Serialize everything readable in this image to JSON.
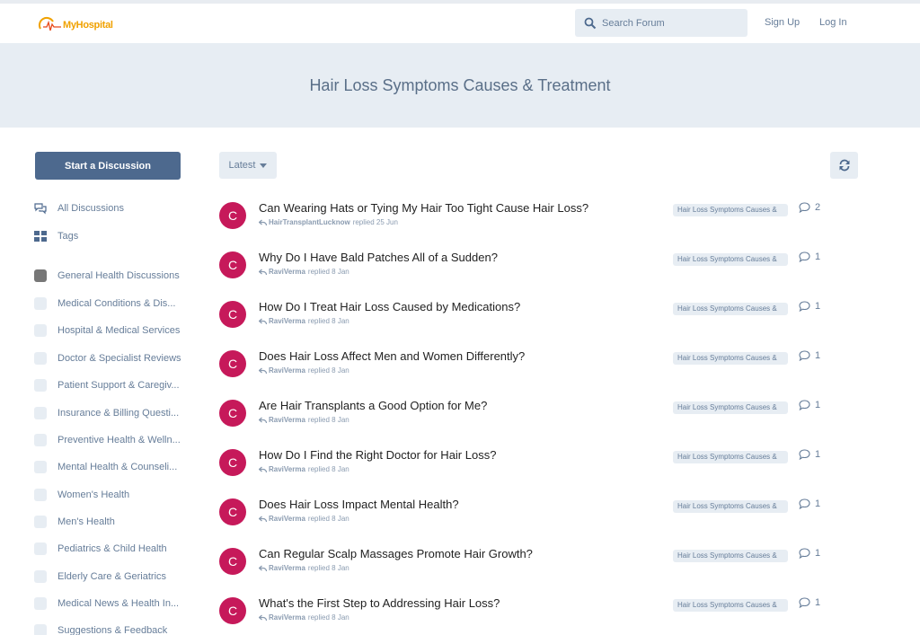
{
  "header": {
    "logo_text": "MyHospital",
    "search_placeholder": "Search Forum",
    "signup_label": "Sign Up",
    "login_label": "Log In"
  },
  "hero": {
    "title": "Hair Loss Symptoms Causes & Treatment"
  },
  "sidebar": {
    "start_label": "Start a Discussion",
    "nav": [
      {
        "label": "All Discussions",
        "icon": "comments-icon"
      },
      {
        "label": "Tags",
        "icon": "tags-grid-icon"
      }
    ],
    "tags": [
      {
        "label": "General Health Discussions"
      },
      {
        "label": "Medical Conditions & Dis..."
      },
      {
        "label": "Hospital & Medical Services"
      },
      {
        "label": "Doctor & Specialist Reviews"
      },
      {
        "label": "Patient Support & Caregiv..."
      },
      {
        "label": "Insurance & Billing Questi..."
      },
      {
        "label": "Preventive Health & Welln..."
      },
      {
        "label": "Mental Health & Counseli..."
      },
      {
        "label": "Women's Health"
      },
      {
        "label": "Men's Health"
      },
      {
        "label": "Pediatrics & Child Health"
      },
      {
        "label": "Elderly Care & Geriatrics"
      },
      {
        "label": "Medical News & Health In..."
      },
      {
        "label": "Suggestions & Feedback"
      }
    ]
  },
  "toolbar": {
    "sort_label": "Latest"
  },
  "discussions": [
    {
      "avatar": "C",
      "title": "Can Wearing Hats or Tying My Hair Too Tight Cause Hair Loss?",
      "user": "HairTransplantLucknow",
      "action": "replied 25 Jun",
      "tag": "Hair Loss Symptoms Causes &",
      "replies": "2"
    },
    {
      "avatar": "C",
      "title": "Why Do I Have Bald Patches All of a Sudden?",
      "user": "RaviVerma",
      "action": "replied 8 Jan",
      "tag": "Hair Loss Symptoms Causes &",
      "replies": "1"
    },
    {
      "avatar": "C",
      "title": "How Do I Treat Hair Loss Caused by Medications?",
      "user": "RaviVerma",
      "action": "replied 8 Jan",
      "tag": "Hair Loss Symptoms Causes &",
      "replies": "1"
    },
    {
      "avatar": "C",
      "title": "Does Hair Loss Affect Men and Women Differently?",
      "user": "RaviVerma",
      "action": "replied 8 Jan",
      "tag": "Hair Loss Symptoms Causes &",
      "replies": "1"
    },
    {
      "avatar": "C",
      "title": "Are Hair Transplants a Good Option for Me?",
      "user": "RaviVerma",
      "action": "replied 8 Jan",
      "tag": "Hair Loss Symptoms Causes &",
      "replies": "1"
    },
    {
      "avatar": "C",
      "title": "How Do I Find the Right Doctor for Hair Loss?",
      "user": "RaviVerma",
      "action": "replied 8 Jan",
      "tag": "Hair Loss Symptoms Causes &",
      "replies": "1"
    },
    {
      "avatar": "C",
      "title": "Does Hair Loss Impact Mental Health?",
      "user": "RaviVerma",
      "action": "replied 8 Jan",
      "tag": "Hair Loss Symptoms Causes &",
      "replies": "1"
    },
    {
      "avatar": "C",
      "title": "Can Regular Scalp Massages Promote Hair Growth?",
      "user": "RaviVerma",
      "action": "replied 8 Jan",
      "tag": "Hair Loss Symptoms Causes &",
      "replies": "1"
    },
    {
      "avatar": "C",
      "title": "What's the First Step to Addressing Hair Loss?",
      "user": "RaviVerma",
      "action": "replied 8 Jan",
      "tag": "Hair Loss Symptoms Causes &",
      "replies": "1"
    }
  ],
  "colors": {
    "accent": "#4d698e",
    "avatar": "#c6195a",
    "panel": "#e7edf3",
    "logo": "#f0a100"
  }
}
